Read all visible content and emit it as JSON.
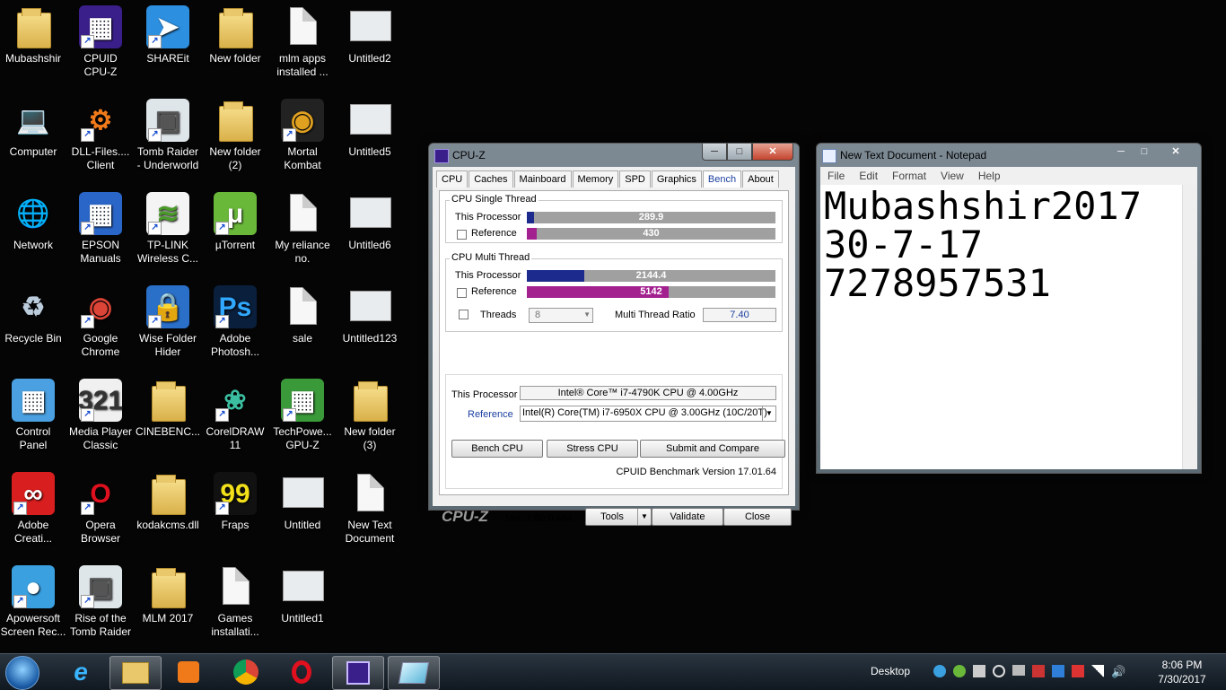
{
  "desktop_icons": [
    {
      "label": "Mubashshir",
      "icon": "user-folder-icon"
    },
    {
      "label": "CPUID\nCPU-Z",
      "icon": "cpuz-icon"
    },
    {
      "label": "SHAREit",
      "icon": "shareit-icon"
    },
    {
      "label": "New folder",
      "icon": "folder-icon"
    },
    {
      "label": "mlm apps\ninstalled ...",
      "icon": "document-icon"
    },
    {
      "label": "Untitled2",
      "icon": "image-file-icon"
    },
    {
      "label": "Computer",
      "icon": "computer-icon"
    },
    {
      "label": "DLL-Files....\nClient",
      "icon": "dll-files-icon"
    },
    {
      "label": "Tomb Raider\n- Underworld",
      "icon": "game-icon"
    },
    {
      "label": "New folder\n(2)",
      "icon": "folder-icon"
    },
    {
      "label": "Mortal\nKombat",
      "icon": "mortal-kombat-icon"
    },
    {
      "label": "Untitled5",
      "icon": "image-file-icon"
    },
    {
      "label": "Network",
      "icon": "network-icon"
    },
    {
      "label": "EPSON\nManuals",
      "icon": "epson-icon"
    },
    {
      "label": "TP-LINK\nWireless C...",
      "icon": "wireless-icon"
    },
    {
      "label": "µTorrent",
      "icon": "utorrent-icon"
    },
    {
      "label": "My reliance\nno.",
      "icon": "document-icon"
    },
    {
      "label": "Untitled6",
      "icon": "image-file-icon"
    },
    {
      "label": "Recycle Bin",
      "icon": "recycle-bin-icon"
    },
    {
      "label": "Google\nChrome",
      "icon": "chrome-icon"
    },
    {
      "label": "Wise Folder\nHider",
      "icon": "folder-lock-icon"
    },
    {
      "label": "Adobe\nPhotosh...",
      "icon": "photoshop-icon"
    },
    {
      "label": "sale",
      "icon": "document-icon"
    },
    {
      "label": "Untitled123",
      "icon": "image-file-icon"
    },
    {
      "label": "Control\nPanel",
      "icon": "control-panel-icon"
    },
    {
      "label": "Media Player\nClassic",
      "icon": "media-player-icon"
    },
    {
      "label": "CINEBENC...",
      "icon": "folder-icon"
    },
    {
      "label": "CorelDRAW\n11",
      "icon": "coreldraw-icon"
    },
    {
      "label": "TechPowe...\nGPU-Z",
      "icon": "gpuz-icon"
    },
    {
      "label": "New folder\n(3)",
      "icon": "folder-icon"
    },
    {
      "label": "Adobe\nCreati...",
      "icon": "creative-cloud-icon"
    },
    {
      "label": "Opera\nBrowser",
      "icon": "opera-icon"
    },
    {
      "label": "kodakcms.dll",
      "icon": "folder-icon"
    },
    {
      "label": "Fraps",
      "icon": "fraps-icon"
    },
    {
      "label": "Untitled",
      "icon": "image-file-icon"
    },
    {
      "label": "New Text\nDocument",
      "icon": "document-icon"
    },
    {
      "label": "Apowersoft\nScreen Rec...",
      "icon": "screen-recorder-icon"
    },
    {
      "label": "Rise of the\nTomb Raider",
      "icon": "game-icon"
    },
    {
      "label": "MLM 2017",
      "icon": "folder-icon"
    },
    {
      "label": "Games\ninstallati...",
      "icon": "document-icon"
    },
    {
      "label": "Untitled1",
      "icon": "image-file-icon"
    }
  ],
  "cpuz": {
    "title": "CPU-Z",
    "tabs": [
      "CPU",
      "Caches",
      "Mainboard",
      "Memory",
      "SPD",
      "Graphics",
      "Bench",
      "About"
    ],
    "selected_tab": "Bench",
    "single_thread": {
      "title": "CPU Single Thread",
      "this_label": "This Processor",
      "this_value": "289.9",
      "this_fraction": 0.03,
      "ref_label": "Reference",
      "ref_value": "430",
      "ref_fraction": 0.04
    },
    "multi_thread": {
      "title": "CPU Multi Thread",
      "this_label": "This Processor",
      "this_value": "2144.4",
      "this_fraction": 0.23,
      "ref_label": "Reference",
      "ref_value": "5142",
      "ref_fraction": 0.57,
      "threads_label": "Threads",
      "threads_value": "8",
      "ratio_label": "Multi Thread Ratio",
      "ratio_value": "7.40"
    },
    "processor_label": "This Processor",
    "processor_value": "Intel® Core™ i7-4790K CPU @ 4.00GHz",
    "reference_label": "Reference",
    "reference_value": "Intel(R) Core(TM) i7-6950X CPU @ 3.00GHz (10C/20T)",
    "bench_button": "Bench CPU",
    "stress_button": "Stress CPU",
    "submit_button": "Submit and Compare",
    "benchmark_version": "CPUID Benchmark Version 17.01.64",
    "brand": "CPU-Z",
    "version": "Ver. 1.80.0.x64",
    "tools_button": "Tools",
    "validate_button": "Validate",
    "close_button": "Close",
    "colors": {
      "this_bar": "#1b2a8c",
      "ref_bar": "#a3208f",
      "bar_bg": "#a0a0a0"
    }
  },
  "notepad": {
    "title": "New Text Document - Notepad",
    "menu": [
      "File",
      "Edit",
      "Format",
      "View",
      "Help"
    ],
    "lines": [
      "Mubashshir2017",
      "30-7-17",
      "7278957531"
    ]
  },
  "taskbar": {
    "show_desktop_label": "Desktop",
    "time": "8:06 PM",
    "date": "7/30/2017",
    "items": [
      "start-orb-icon",
      "internet-explorer-icon",
      "file-explorer-icon",
      "media-player-icon",
      "chrome-icon",
      "opera-icon",
      "cpuz-icon",
      "snipping-tool-icon"
    ]
  }
}
